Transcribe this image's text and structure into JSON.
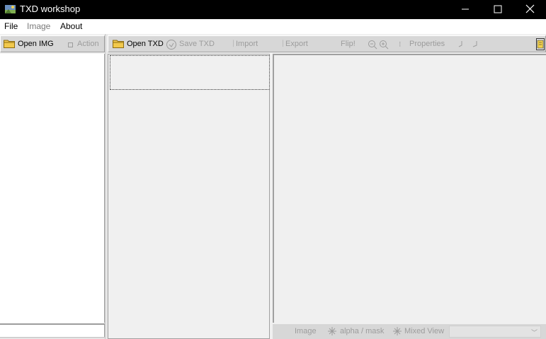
{
  "window": {
    "title": "TXD workshop",
    "controls": {
      "minimize": "—",
      "maximize": "☐",
      "close": "✕"
    }
  },
  "menu": {
    "file": "File",
    "image": "Image",
    "about": "About"
  },
  "left_toolbar": {
    "open_img": "Open IMG",
    "action": "Action"
  },
  "main_toolbar": {
    "open_txd": "Open TXD",
    "save_txd": "Save TXD",
    "import": "Import",
    "export": "Export",
    "flip": "Flip!",
    "properties": "Properties"
  },
  "bottom_bar": {
    "image": "Image",
    "alpha_mask": "alpha / mask",
    "mixed_view": "Mixed View",
    "combo_value": ""
  },
  "colors": {
    "folder": "#f2c94c",
    "disabled": "#9c9c9c"
  }
}
